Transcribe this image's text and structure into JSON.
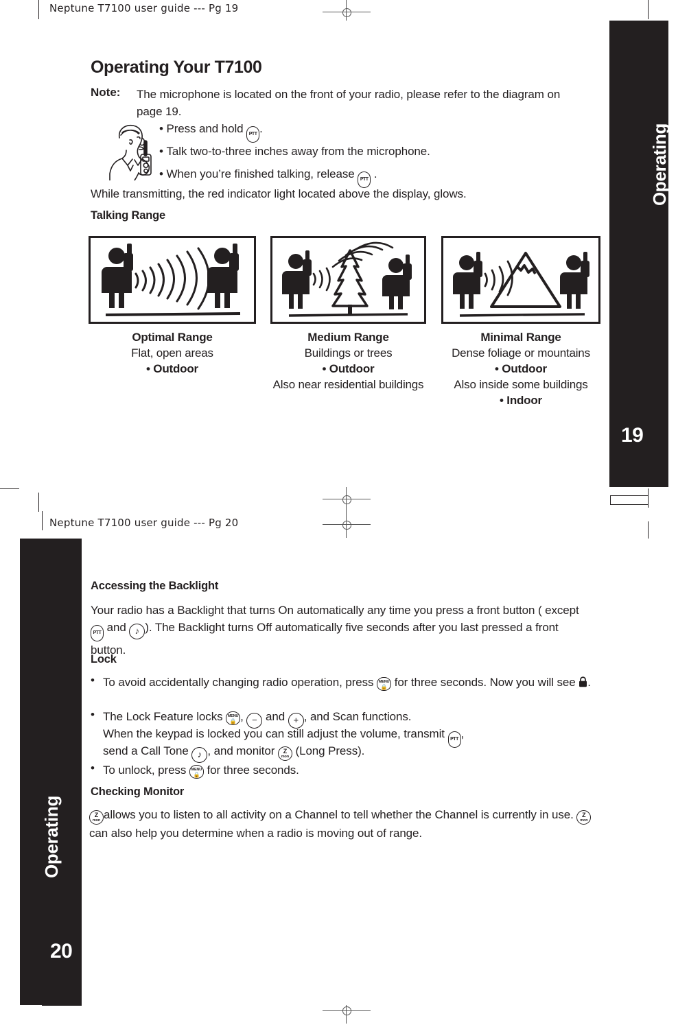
{
  "document": {
    "slug_page19": "Neptune T7100 user guide --- Pg 19",
    "slug_page20": "Neptune T7100 user guide --- Pg 20"
  },
  "page19": {
    "tab": {
      "label": "Operating",
      "page_number": "19"
    },
    "title": "Operating Your T7100",
    "note": {
      "label": "Note:",
      "text": "The microphone is located on the front of your radio, please refer to the diagram on page 19."
    },
    "bullets": [
      {
        "before": "Press and hold",
        "key": "PTT",
        "after": "."
      },
      {
        "before": "Talk two-to-three inches away from the microphone.",
        "key": "",
        "after": ""
      },
      {
        "before": "When you’re finished talking, release",
        "key": "PTT",
        "after": "."
      }
    ],
    "transmitting_text": "While transmitting, the red indicator light located above the display, glows.",
    "talking_range_heading": "Talking Range",
    "ranges": [
      {
        "icon": "two-people-open-area-icon",
        "title": "Optimal Range",
        "line1": "Flat, open areas",
        "bullet1": "• Outdoor",
        "line2": "",
        "bullet2": ""
      },
      {
        "icon": "two-people-tree-icon",
        "title": "Medium Range",
        "line1": "Buildings or trees",
        "bullet1": "• Outdoor",
        "line2": "Also near residential buildings",
        "bullet2": ""
      },
      {
        "icon": "two-people-mountain-icon",
        "title": "Minimal Range",
        "line1": "Dense foliage or mountains",
        "bullet1": "• Outdoor",
        "line2": "Also inside some buildings",
        "bullet2": "• Indoor"
      }
    ]
  },
  "page20": {
    "tab": {
      "label": "Operating",
      "page_number": "20"
    },
    "backlight": {
      "heading": "Accessing the Backlight",
      "part1": "Your radio has a Backlight that turns On automatically any time you press a front button ( except",
      "part2": "and",
      "part3": "). The Backlight turns Off automatically five seconds after you last pressed a front button."
    },
    "lock": {
      "heading": "Lock",
      "b1_p1": "To avoid accidentally changing radio operation, press",
      "b1_p2": "for three seconds. Now you will see",
      "b1_p3": ".",
      "b2_p1": "The Lock Feature locks",
      "b2_p2": ",",
      "b2_p3": "and",
      "b2_p4": ", and Scan functions.",
      "b2_p5": "When the keypad is locked you can still adjust the volume, transmit",
      "b2_p6": ",",
      "b2_p7": "send a Call Tone",
      "b2_p8": ", and monitor",
      "b2_p9": "(Long Press).",
      "b3_p1": "To unlock, press",
      "b3_p2": "for three seconds."
    },
    "monitor": {
      "heading": "Checking Monitor",
      "p1": "allows you to listen to all activity on a Channel to tell whether the Channel is currently in use.",
      "p2": "can also help you determine when a radio is moving out of range."
    }
  },
  "keys": {
    "ptt": "PTT",
    "menu_top": "MENU",
    "minus": "−",
    "plus": "+",
    "note_glyph": "♪",
    "mon_top": "Z",
    "mon_bottom": "mon"
  },
  "colors": {
    "ink": "#231f20",
    "paper": "#ffffff",
    "tab": "#231f20"
  }
}
